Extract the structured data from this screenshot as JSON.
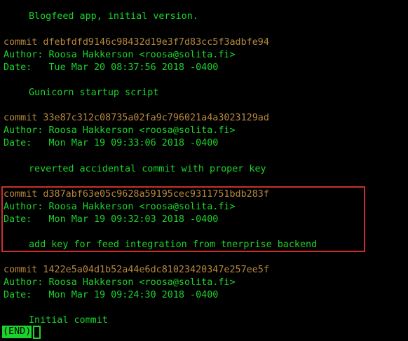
{
  "colors": {
    "text": "#1bd42b",
    "commit_hash": "#b7883e",
    "highlight_border": "#c8302f",
    "background": "#000000"
  },
  "top_message": "Blogfeed app, initial version.",
  "commits": [
    {
      "commit": "commit dfebfdfd9146c98432d19e3f7d83cc5f3adbfe94",
      "author": "Author: Roosa Hakkerson <roosa@solita.fi>",
      "date": "Date:   Tue Mar 20 08:37:56 2018 -0400",
      "message": "Gunicorn startup script"
    },
    {
      "commit": "commit 33e87c312c08735a02fa9c796021a4a3023129ad",
      "author": "Author: Roosa Hakkerson <roosa@solita.fi>",
      "date": "Date:   Mon Mar 19 09:33:06 2018 -0400",
      "message": "reverted accidental commit with proper key"
    },
    {
      "commit": "commit d387abf63e05c9628a59195cec9311751bdb283f",
      "author": "Author: Roosa Hakkerson <roosa@solita.fi>",
      "date": "Date:   Mon Mar 19 09:32:03 2018 -0400",
      "message": "add key for feed integration from tnerprise backend"
    },
    {
      "commit": "commit 1422e5a04d1b52a44e6dc81023420347e257ee5f",
      "author": "Author: Roosa Hakkerson <roosa@solita.fi>",
      "date": "Date:   Mon Mar 19 09:24:30 2018 -0400",
      "message": "Initial commit"
    }
  ],
  "pager_status": "(END)"
}
